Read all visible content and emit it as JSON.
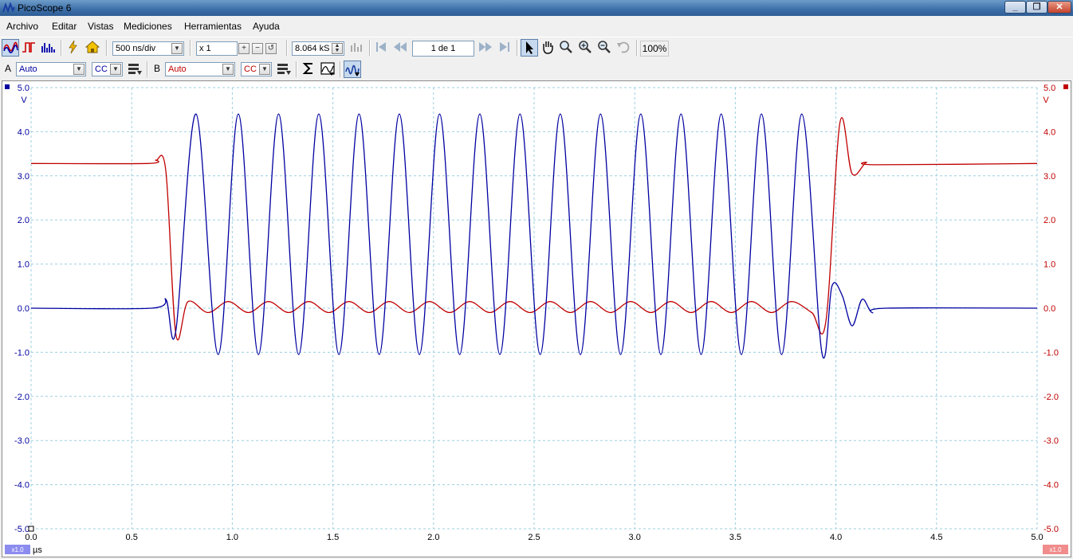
{
  "window": {
    "title": "PicoScope 6"
  },
  "menu": [
    "Archivo",
    "Editar",
    "Vistas",
    "Mediciones",
    "Herramientas",
    "Ayuda"
  ],
  "toolbar": {
    "timebase": "500 ns/div",
    "zoom_factor": "x 1",
    "samples": "8.064 kS",
    "buffer_page": "1 de 1",
    "zoom_percent": "100%"
  },
  "channels": {
    "a": {
      "label": "A",
      "range": "Auto",
      "coupling": "CC",
      "color": "#0000a0"
    },
    "b": {
      "label": "B",
      "range": "Auto",
      "coupling": "CC",
      "color": "#c00000"
    }
  },
  "chart_data": {
    "type": "line",
    "xlabel": "µs",
    "ylabel_left": "V",
    "ylabel_right": "V",
    "xlim": [
      0.0,
      5.0
    ],
    "ylim": [
      -5.0,
      5.0
    ],
    "x_ticks": [
      "0.0",
      "0.5",
      "1.0",
      "1.5",
      "2.0",
      "2.5",
      "3.0",
      "3.5",
      "4.0",
      "4.5",
      "5.0"
    ],
    "y_ticks": [
      "5.0",
      "4.0",
      "3.0",
      "2.0",
      "1.0",
      "0.0",
      "-1.0",
      "-2.0",
      "-3.0",
      "-4.0",
      "-5.0"
    ],
    "grid": true,
    "scale_badges": {
      "left": "x1.0",
      "right": "x1.0"
    },
    "series": [
      {
        "name": "A",
        "color": "#0000a0",
        "points": [
          [
            0.0,
            0.0
          ],
          [
            0.6,
            0.0
          ],
          [
            0.67,
            0.2
          ],
          [
            0.72,
            -0.5
          ],
          [
            0.82,
            4.4
          ],
          [
            0.93,
            -1.05
          ],
          [
            1.03,
            4.4
          ],
          [
            1.13,
            -1.05
          ],
          [
            1.23,
            4.4
          ],
          [
            1.33,
            -1.05
          ],
          [
            1.43,
            4.4
          ],
          [
            1.53,
            -1.05
          ],
          [
            1.63,
            4.4
          ],
          [
            1.73,
            -1.05
          ],
          [
            1.83,
            4.4
          ],
          [
            1.93,
            -1.05
          ],
          [
            2.03,
            4.4
          ],
          [
            2.13,
            -1.05
          ],
          [
            2.23,
            4.4
          ],
          [
            2.33,
            -1.05
          ],
          [
            2.43,
            4.4
          ],
          [
            2.53,
            -1.05
          ],
          [
            2.63,
            4.4
          ],
          [
            2.73,
            -1.05
          ],
          [
            2.83,
            4.4
          ],
          [
            2.93,
            -1.05
          ],
          [
            3.03,
            4.4
          ],
          [
            3.13,
            -1.05
          ],
          [
            3.23,
            4.4
          ],
          [
            3.33,
            -1.05
          ],
          [
            3.43,
            4.4
          ],
          [
            3.53,
            -1.05
          ],
          [
            3.63,
            4.4
          ],
          [
            3.73,
            -1.05
          ],
          [
            3.83,
            4.4
          ],
          [
            3.93,
            -1.0
          ],
          [
            3.98,
            0.5
          ],
          [
            4.03,
            0.3
          ],
          [
            4.08,
            -0.4
          ],
          [
            4.13,
            0.2
          ],
          [
            4.18,
            -0.1
          ],
          [
            4.25,
            0.0
          ],
          [
            5.0,
            0.0
          ]
        ]
      },
      {
        "name": "B",
        "color": "#c00000",
        "points": [
          [
            0.0,
            3.28
          ],
          [
            0.58,
            3.28
          ],
          [
            0.62,
            3.35
          ],
          [
            0.67,
            3.1
          ],
          [
            0.72,
            -0.6
          ],
          [
            0.78,
            0.15
          ],
          [
            0.88,
            -0.1
          ],
          [
            0.98,
            0.15
          ],
          [
            1.08,
            -0.1
          ],
          [
            1.18,
            0.15
          ],
          [
            1.28,
            -0.1
          ],
          [
            1.38,
            0.15
          ],
          [
            1.48,
            -0.1
          ],
          [
            1.58,
            0.15
          ],
          [
            1.68,
            -0.1
          ],
          [
            1.78,
            0.15
          ],
          [
            1.88,
            -0.1
          ],
          [
            1.98,
            0.15
          ],
          [
            2.08,
            -0.1
          ],
          [
            2.18,
            0.15
          ],
          [
            2.28,
            -0.1
          ],
          [
            2.38,
            0.15
          ],
          [
            2.48,
            -0.1
          ],
          [
            2.58,
            0.15
          ],
          [
            2.68,
            -0.1
          ],
          [
            2.78,
            0.15
          ],
          [
            2.88,
            -0.1
          ],
          [
            2.98,
            0.15
          ],
          [
            3.08,
            -0.1
          ],
          [
            3.18,
            0.15
          ],
          [
            3.28,
            -0.1
          ],
          [
            3.38,
            0.15
          ],
          [
            3.48,
            -0.1
          ],
          [
            3.58,
            0.15
          ],
          [
            3.68,
            -0.1
          ],
          [
            3.78,
            0.15
          ],
          [
            3.88,
            -0.1
          ],
          [
            3.95,
            -0.3
          ],
          [
            4.02,
            4.2
          ],
          [
            4.08,
            3.05
          ],
          [
            4.15,
            3.3
          ],
          [
            4.2,
            3.25
          ],
          [
            5.0,
            3.28
          ]
        ]
      }
    ]
  }
}
